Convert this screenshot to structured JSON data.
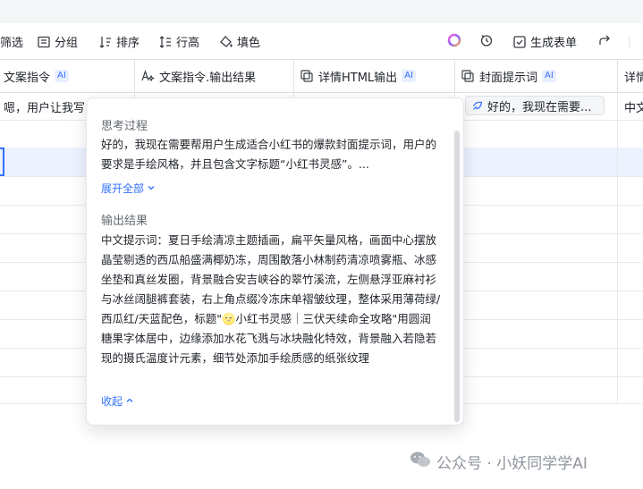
{
  "toolbar": {
    "filter_label": "筛选",
    "group_label": "分组",
    "sort_label": "排序",
    "row_height_label": "行高",
    "fill_label": "填色",
    "generate_form_label": "生成表单"
  },
  "columns": {
    "col1": "文案指令",
    "col1_badge": "AI",
    "col2": "文案指令.输出结果",
    "col3": "详情HTML输出",
    "col3_badge": "AI",
    "col4": "封面提示词",
    "col4_badge": "AI",
    "col5": "详情"
  },
  "rows": {
    "first_row_col1": "嗯，用户让我写",
    "first_row_chip": "好的，我现在需要...",
    "first_row_col5": "中文"
  },
  "popup": {
    "thinking_title": "思考过程",
    "thinking_text": "好的，我现在需要帮用户生成适合小红书的爆款封面提示词，用户的要求是手绘风格，并且包含文字标题“小红书灵感”。...",
    "expand_label": "展开全部",
    "output_title": "输出结果",
    "output_text": "中文提示词：夏日手绘清凉主题插画，扁平矢量风格，画面中心摆放晶莹剔透的西瓜船盛满椰奶冻，周围散落小林制药清凉喷雾瓶、冰感坐垫和真丝发圈，背景融合安吉峡谷的翠竹溪流，左侧悬浮亚麻衬衫与冰丝阔腿裤套装，右上角点缀冷冻床单褶皱纹理，整体采用薄荷绿/西瓜红/天蓝配色，标题\"🌝小红书灵感｜三伏天续命全攻略\"用圆润糖果字体居中，边缘添加水花飞溅与冰块融化特效，背景融入若隐若现的摄氏温度计元素，细节处添加手绘质感的纸张纹理",
    "collapse_label": "收起"
  },
  "watermark": {
    "text": "公众号 · 小妖同学学AI"
  },
  "colors": {
    "accent": "#3370ff",
    "selected_row": "#edf2ff",
    "muted_text": "#646a73"
  }
}
